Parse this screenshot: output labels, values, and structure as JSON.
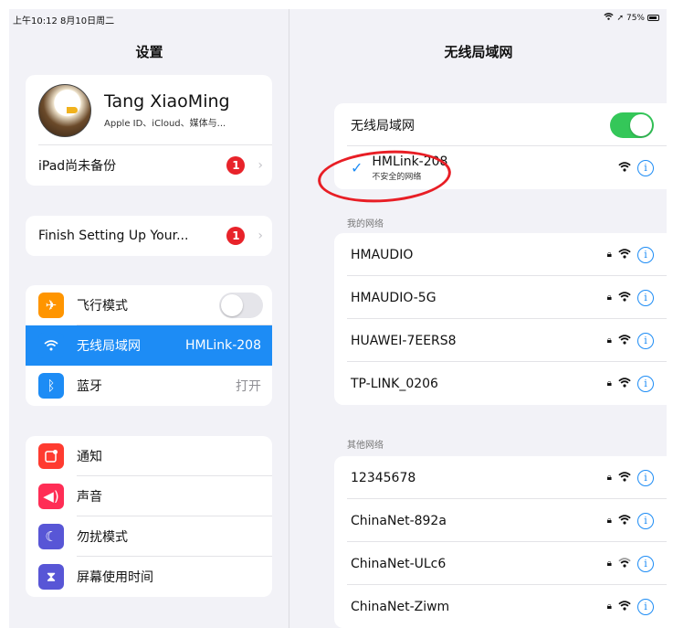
{
  "status_bar": {
    "time": "上午10:12  8月10日周二",
    "battery": "75%"
  },
  "sidebar": {
    "title": "设置",
    "profile": {
      "name": "Tang XiaoMing",
      "subtitle": "Apple ID、iCloud、媒体与..."
    },
    "backup": {
      "label": "iPad尚未备份",
      "badge": "1"
    },
    "finish_setup": {
      "label": "Finish Setting Up Your...",
      "badge": "1"
    },
    "connectivity": [
      {
        "label": "飞行模式",
        "icon": "airplane-icon",
        "color": "#ff9500"
      },
      {
        "label": "无线局域网",
        "value": "HMLink-208",
        "icon": "wifi-icon",
        "color": "#1d8cf5"
      },
      {
        "label": "蓝牙",
        "value": "打开",
        "icon": "bluetooth-icon",
        "color": "#1d8cf5"
      }
    ],
    "notifications": [
      {
        "label": "通知",
        "icon": "notifications-icon",
        "color": "#ff3b30"
      },
      {
        "label": "声音",
        "icon": "sound-icon",
        "color": "#ff2d55"
      },
      {
        "label": "勿扰模式",
        "icon": "moon-icon",
        "color": "#5856d6"
      },
      {
        "label": "屏幕使用时间",
        "icon": "hourglass-icon",
        "color": "#5856d6"
      }
    ]
  },
  "wifi": {
    "title": "无线局域网",
    "toggle_label": "无线局域网",
    "connected": {
      "name": "HMLink-208",
      "subtitle": "不安全的网络"
    },
    "my_networks_header": "我的网络",
    "my_networks": [
      "HMAUDIO",
      "HMAUDIO-5G",
      "HUAWEI-7EERS8",
      "TP-LINK_0206"
    ],
    "other_networks_header": "其他网络",
    "other_networks": [
      "12345678",
      "ChinaNet-892a",
      "ChinaNet-ULc6",
      "ChinaNet-Ziwm"
    ]
  }
}
